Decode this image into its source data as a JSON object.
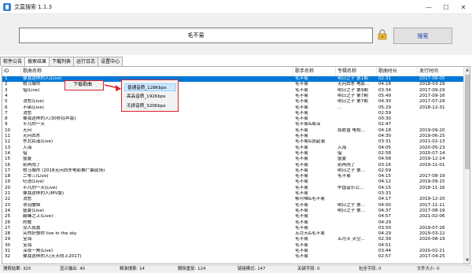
{
  "window": {
    "title": "艾莫搜索 1.1.3",
    "minimize": "—",
    "maximize": "☐",
    "close": "✕"
  },
  "search": {
    "value": "毛不易",
    "button": "搜索"
  },
  "tabs": [
    "软件公告",
    "搜索结果",
    "下载列表",
    "运行日志",
    "设置中心"
  ],
  "table": {
    "headers": [
      "ID",
      "歌曲名称",
      "歌手名称",
      "专辑名称",
      "歌曲时长",
      "发行时间"
    ],
    "rows": [
      [
        "1",
        "像我这样的人(Live)",
        "毛不易",
        "明日之子 第1期",
        "02:31",
        "2017-08-05"
      ],
      [
        "2",
        "牧马城市",
        "毛不易",
        "无问西东 电影...",
        "04:18",
        "2018-03-29"
      ],
      [
        "3",
        "借(Live)",
        "毛不易",
        "明日之子 第9期",
        "03:34",
        "2017-09-29"
      ],
      [
        "4",
        "",
        "毛不易",
        "明日之子 第7期",
        "05:49",
        "2017-09-16"
      ],
      [
        "5",
        "消愁(Live)",
        "毛不易",
        "明日之子 第7期",
        "04:30",
        "2017-07-29"
      ],
      [
        "6",
        "不染(Live)",
        "毛不易",
        "...",
        "05:29",
        "2018-12-31"
      ],
      [
        "7",
        "消愁",
        "毛不易",
        "",
        "02:59",
        ""
      ],
      [
        "8",
        "像我这样的人(30秒铃声版)",
        "毛不易",
        "",
        "00:30",
        ""
      ],
      [
        "9",
        "平凡的一天",
        "毛不易&周深",
        "",
        "02:47",
        ""
      ],
      [
        "10",
        "无问",
        "毛不易",
        "如愿香 电视...",
        "04:18",
        "2019-09-20"
      ],
      [
        "11",
        "无问西东",
        "毛不易",
        "",
        "04:30",
        "2019-06-25"
      ],
      [
        "12",
        "东北民谣(Live)",
        "毛不易&张韶涵",
        "",
        "03:31",
        "2021-02-13"
      ],
      [
        "13",
        "入海",
        "毛不易",
        "入海",
        "04:05",
        "2020-05-23"
      ],
      [
        "14",
        "借",
        "毛不易",
        "借",
        "02:58",
        "2020-07-14"
      ],
      [
        "15",
        "盛夏",
        "毛不易",
        "盛夏",
        "04:58",
        "2019-12-24"
      ],
      [
        "16",
        "别再闹了",
        "毛不易",
        "别再闹了",
        "03:16",
        "2019-11-01"
      ],
      [
        "17",
        "牧马城市 (2018无问西东电影推广曲现场)",
        "毛不易",
        "明日之子 第...",
        "02:59",
        ""
      ],
      [
        "18",
        "二零三(Live)",
        "毛不易",
        "毛不易",
        "04:15",
        "2017-08-19"
      ],
      [
        "19",
        "呓语(Live)",
        "毛不易",
        "",
        "04:12",
        "2019-09-15"
      ],
      [
        "20",
        "平凡的一天(Live)",
        "毛不易",
        "中国音乐公...",
        "04:15",
        "2018-11-16"
      ],
      [
        "21",
        "像我这样的人(MV版)",
        "毛不易",
        "",
        "03:33",
        ""
      ],
      [
        "22",
        "消愁",
        "郁可唯&毛不易",
        "",
        "04:17",
        "2019-12-20"
      ],
      [
        "23",
        "项羽虞姬",
        "毛不易",
        "明日之子 第...",
        "04:00",
        "2017-11-11"
      ],
      [
        "24",
        "盛夏(Live)",
        "毛不易",
        "明日之子 第...",
        "04:37",
        "2017-08-19"
      ],
      [
        "25",
        "巅峰之上(Live)",
        "毛不易",
        "",
        "04:57",
        "2021-02-06"
      ],
      [
        "26",
        "的歌",
        "毛不易",
        "",
        "04:29",
        ""
      ],
      [
        "27",
        "没人寂寞",
        "毛不易",
        "",
        "03:50",
        "2019-07-26"
      ],
      [
        "28",
        "突然好想你 live in the sky",
        "五月天&毛不易",
        "",
        "04:29",
        "2019-03-22"
      ],
      [
        "29",
        "宝海",
        "毛不易",
        "五月天 天空...",
        "02:39",
        "2020-08-19"
      ],
      [
        "30",
        "宝海",
        "毛不易",
        "",
        "04:51",
        ""
      ],
      [
        "31",
        "深夜一角(Live)",
        "毛不易",
        "",
        "03:44",
        "2020-02-21"
      ],
      [
        "32",
        "像我这样的人(天天向上2017)",
        "毛不易",
        "",
        "02:57",
        "2017-04-25"
      ]
    ]
  },
  "context_menu": {
    "item": "下载歌曲",
    "sub_items": [
      "普通音质_128Kbps",
      "高品音质_192Kbps",
      "无损音质_320Kbps"
    ]
  },
  "status": {
    "items": [
      "搜索结果: 325",
      "显示输出: 40",
      "精准搜索: 14",
      "删除重复: 124",
      "链接模式: 147",
      "关键字段: 0",
      "包含字段: 0",
      "文件大小: 0"
    ]
  },
  "colors": {
    "selection": "#0078d7",
    "highlight_border": "#d9262e",
    "button_text": "#1a3fb0"
  }
}
